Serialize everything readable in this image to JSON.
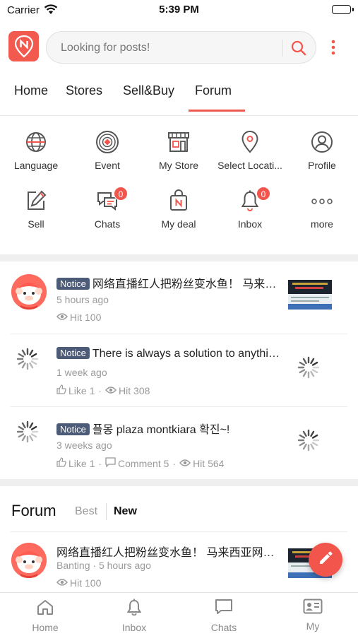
{
  "status_bar": {
    "carrier": "Carrier",
    "time": "5:39 PM"
  },
  "header": {
    "search_placeholder": "Looking for posts!"
  },
  "tabs": [
    {
      "label": "Home"
    },
    {
      "label": "Stores"
    },
    {
      "label": "Sell&Buy"
    },
    {
      "label": "Forum",
      "active": true
    }
  ],
  "quick_menu": [
    {
      "label": "Language",
      "icon": "globe-icon"
    },
    {
      "label": "Event",
      "icon": "target-icon"
    },
    {
      "label": "My Store",
      "icon": "store-icon"
    },
    {
      "label": "Select Locati...",
      "icon": "location-pin-icon"
    },
    {
      "label": "Profile",
      "icon": "profile-icon"
    },
    {
      "label": "Sell",
      "icon": "edit-icon"
    },
    {
      "label": "Chats",
      "icon": "chat-bubbles-icon",
      "badge": "0"
    },
    {
      "label": "My deal",
      "icon": "shopping-bag-icon"
    },
    {
      "label": "Inbox",
      "icon": "bell-icon",
      "badge": "0"
    },
    {
      "label": "more",
      "icon": "more-dots-icon"
    }
  ],
  "notices": [
    {
      "tag": "Notice",
      "title": "网络直播红人把粉丝变水鱼！ 马来西亚...",
      "time": "5 hours ago",
      "hit": "Hit 100"
    },
    {
      "tag": "Notice",
      "title": "There is always a solution to anything...",
      "time": "1 week ago",
      "like": "Like 1",
      "hit": "Hit 308"
    },
    {
      "tag": "Notice",
      "title": "플몽 plaza montkiara 확진~!",
      "time": "3 weeks ago",
      "like": "Like 1",
      "comment": "Comment 5",
      "hit": "Hit 564"
    }
  ],
  "forum": {
    "title": "Forum",
    "filters": {
      "best": "Best",
      "new": "New"
    },
    "posts": [
      {
        "title": "网络直播红人把粉丝变水鱼！ 马来西亚网红...",
        "location": "Banting",
        "time": "5 hours ago",
        "hit": "Hit 100"
      }
    ]
  },
  "bottom_nav": [
    {
      "label": "Home",
      "icon": "home-icon"
    },
    {
      "label": "Inbox",
      "icon": "bell-icon"
    },
    {
      "label": "Chats",
      "icon": "chat-icon"
    },
    {
      "label": "My",
      "icon": "id-card-icon"
    }
  ],
  "colors": {
    "accent": "#f2554b",
    "notice_tag": "#4c5c78"
  }
}
